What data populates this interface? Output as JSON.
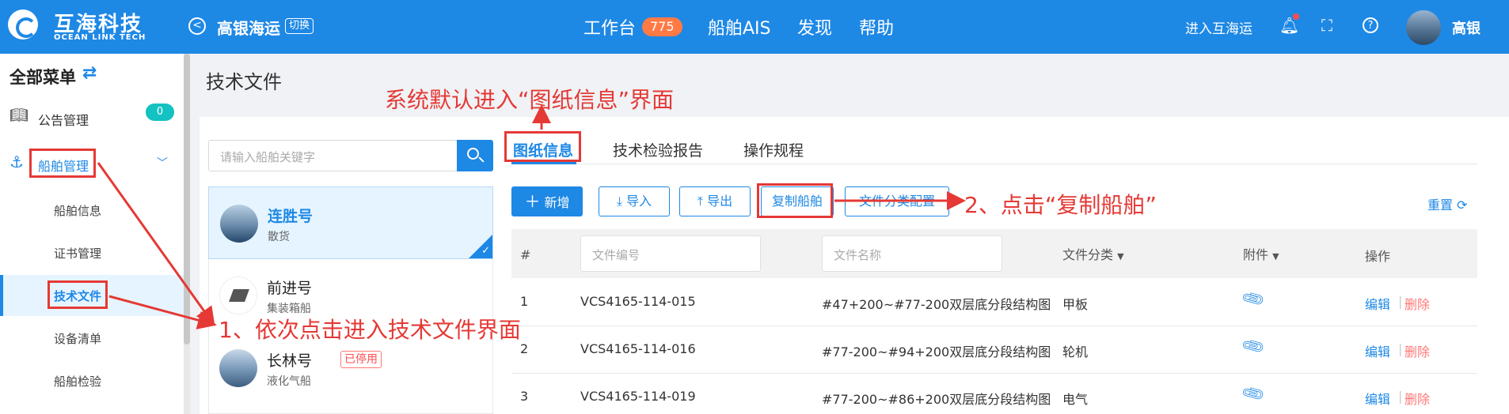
{
  "header": {
    "brand_cn": "互海科技",
    "brand_en": "OCEAN LINK TECH",
    "company": "高银海运",
    "switch_label": "切换",
    "nav": [
      {
        "label": "工作台",
        "badge": "775"
      },
      {
        "label": "船舶AIS"
      },
      {
        "label": "发现"
      },
      {
        "label": "帮助"
      }
    ],
    "enter_link": "进入互海运",
    "user_name": "高银",
    "icons": [
      "bell-icon",
      "fullscreen-icon",
      "help-icon"
    ]
  },
  "sidebar": {
    "title": "全部菜单",
    "announcement": {
      "label": "公告管理",
      "badge": "0"
    },
    "ship_mgmt": "船舶管理",
    "sub_items": [
      "船舶信息",
      "证书管理",
      "技术文件",
      "设备清单",
      "船舶检验"
    ]
  },
  "page": {
    "title": "技术文件"
  },
  "ship_panel": {
    "search_placeholder": "请输入船舶关键字",
    "ships": [
      {
        "name": "连胜号",
        "type": "散货",
        "selected": true
      },
      {
        "name": "前进号",
        "type": "集装箱船"
      },
      {
        "name": "长林号",
        "type": "液化气船",
        "badge": "已停用"
      }
    ]
  },
  "tabs": [
    "图纸信息",
    "技术检验报告",
    "操作规程"
  ],
  "toolbar": {
    "add": "新增",
    "import": "导入",
    "export": "导出",
    "copy_ship": "复制船舶",
    "classify_config": "文件分类配置",
    "reset": "重置"
  },
  "table": {
    "headers": {
      "index": "#",
      "code_placeholder": "文件编号",
      "name_placeholder": "文件名称",
      "category": "文件分类",
      "attachment": "附件",
      "action": "操作"
    },
    "rows": [
      {
        "index": "1",
        "code": "VCS4165-114-015",
        "name": "#47+200~#77-200双层底分段结构图",
        "category": "甲板"
      },
      {
        "index": "2",
        "code": "VCS4165-114-016",
        "name": "#77-200~#94+200双层底分段结构图",
        "category": "轮机"
      },
      {
        "index": "3",
        "code": "VCS4165-114-019",
        "name": "#77-200~#86+200双层底分段结构图",
        "category": "电气"
      }
    ],
    "edit": "编辑",
    "delete": "删除"
  },
  "annotations": {
    "default_tab": "系统默认进入“图纸信息”界面",
    "step1": "1、依次点击进入技术文件界面",
    "step2": "2、点击“复制船舶”"
  },
  "colors": {
    "primary": "#1e88e5",
    "annotation": "#e53935",
    "badge": "#ff7a45",
    "teal_badge": "#13c2c2"
  }
}
